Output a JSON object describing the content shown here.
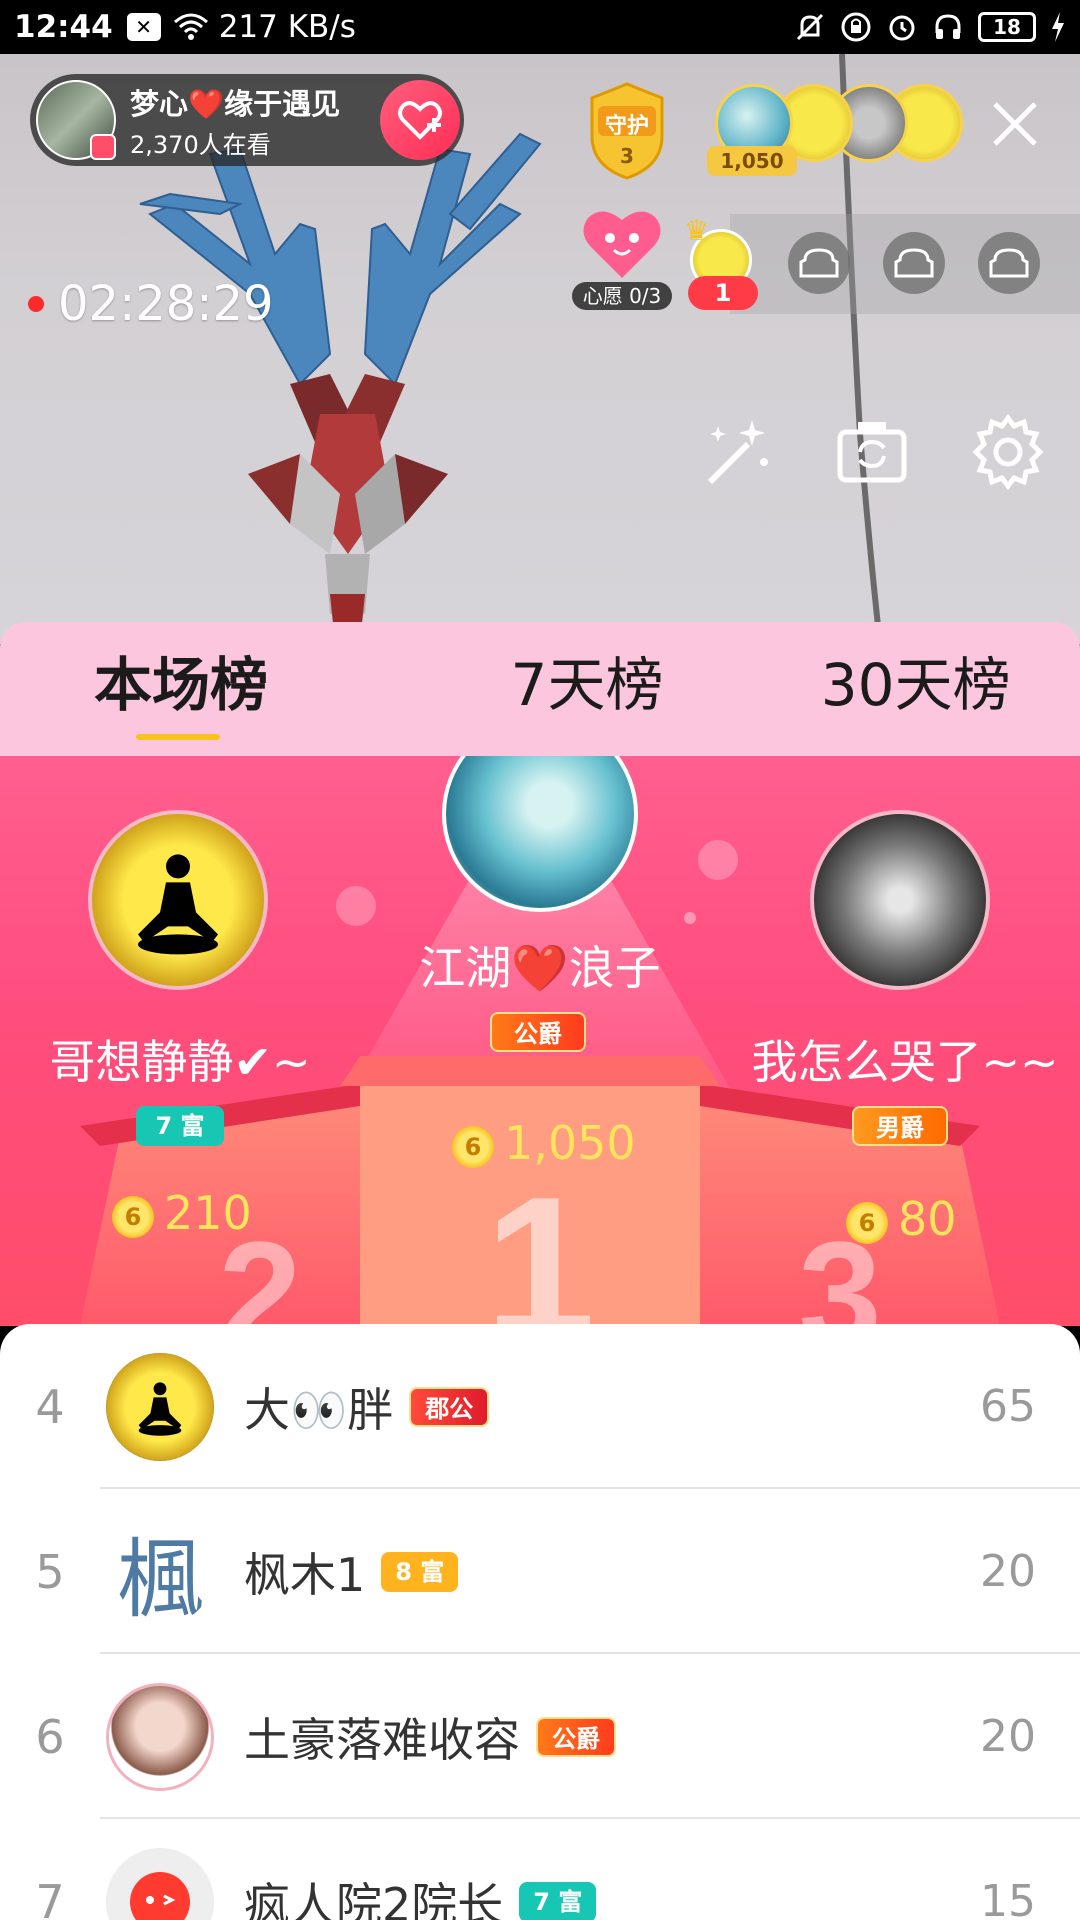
{
  "status_bar": {
    "time": "12:44",
    "net_speed": "217 KB/s",
    "battery": "18",
    "icons": [
      "notification-x-icon",
      "wifi-icon",
      "mute-bell-icon",
      "lock-rotation-icon",
      "alarm-icon",
      "headphones-icon",
      "battery-icon",
      "charging-icon"
    ]
  },
  "host": {
    "name": "梦心❤️缘于遇见",
    "viewers": "2,370人在看",
    "follow_icon": "heart-plus-icon"
  },
  "guard": {
    "label": "守护",
    "count": "3"
  },
  "top_fans": {
    "score": "1,050"
  },
  "timer": "02:28:29",
  "wish": {
    "label": "心愿 0/3"
  },
  "seat": {
    "number": "1"
  },
  "tabs": [
    {
      "label": "本场榜",
      "active": true
    },
    {
      "label": "7天榜",
      "active": false
    },
    {
      "label": "30天榜",
      "active": false
    }
  ],
  "podium": {
    "first": {
      "name": "江湖❤️浪子",
      "badge": "公爵",
      "score": "1,050",
      "rank": "1"
    },
    "second": {
      "name": "哥想静静✔~",
      "badge": "7 富",
      "score": "210",
      "rank": "2"
    },
    "third": {
      "name": "我怎么哭了~~",
      "badge": "男爵",
      "score": "80",
      "rank": "3"
    }
  },
  "coin_symbol": "6",
  "list": [
    {
      "rank": "4",
      "name": "大👀胖",
      "badge": "郡公",
      "badge_type": "count",
      "score": "65",
      "avatar": "moon"
    },
    {
      "rank": "5",
      "name": "枫木1",
      "badge": "8 富",
      "badge_type": "rich8",
      "score": "20",
      "avatar": "maple"
    },
    {
      "rank": "6",
      "name": "土豪落难收容",
      "badge": "公爵",
      "badge_type": "duke",
      "score": "20",
      "avatar": "girl"
    },
    {
      "rank": "7",
      "name": "疯人院2院长",
      "badge": "7 富",
      "badge_type": "rich",
      "score": "15",
      "avatar": "red"
    }
  ],
  "maple_char": "楓",
  "colors": {
    "accent_pink": "#ff4d7e",
    "tab_bg": "#fcc6de",
    "gold": "#ffe45c",
    "underline": "#f8c31a"
  }
}
